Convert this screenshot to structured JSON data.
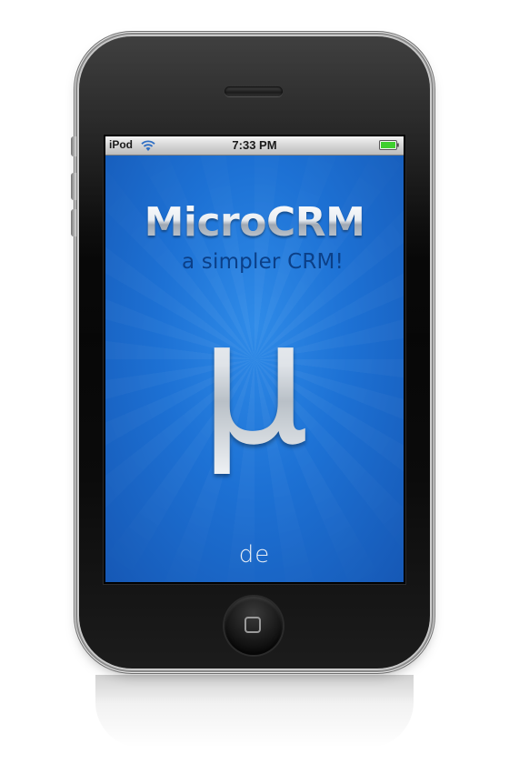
{
  "status_bar": {
    "carrier": "iPod",
    "time": "7:33 PM",
    "battery_color": "#3fcf2f"
  },
  "splash": {
    "app_name": "MicroCRM",
    "tagline": "a simpler CRM!",
    "logo_glyph": "μ",
    "company_mark": "de",
    "background_color": "#1e6fd1"
  },
  "icons": {
    "wifi": "wifi-icon",
    "battery": "battery-icon",
    "home": "home-button-icon"
  }
}
